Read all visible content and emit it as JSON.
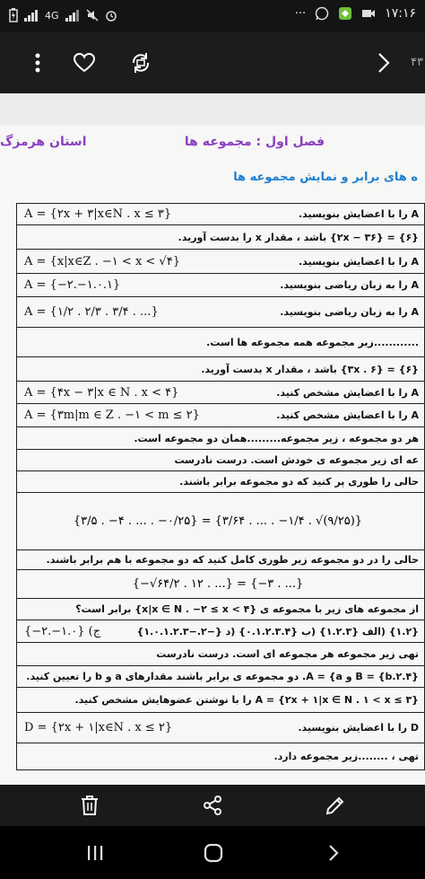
{
  "status_bar": {
    "time": "۱۷:۱۶",
    "network_label": "4G",
    "more": "···"
  },
  "toolbar": {
    "page_indicator": "۴۳"
  },
  "document": {
    "chapter_title": "فصل اول : مجموعه ها",
    "province": "استان هرمزگ",
    "section_title": "ه های برابر و نمایش مجموعه ها",
    "rows": [
      {
        "text": "A را با اعضایش بنویسید.",
        "math": "A = {۲x + ۳|x∈N . x ≤ ۳}"
      },
      {
        "text": "{۶} = {۲x − ۳۶} باشد ، مقدار x را بدست آورید.",
        "math": ""
      },
      {
        "text": "A را با اعضایش بنویسید.",
        "math": "A = {x|x∈Z . −۱ < x < √۴}"
      },
      {
        "text": "A را به زبان ریاضی بنویسید.",
        "math": "A = {−۲.−۱.۰.۱}"
      },
      {
        "text": "A را به زبان ریاضی بنویسید.",
        "math": "A = {۱/۲ . ۲/۳ . ۳/۴ . ...}"
      },
      {
        "text": "............زیر مجموعه همه مجموعه ها است.",
        "math": ""
      },
      {
        "text": "{۶} = {۳x . ۶} باشد ، مقدار x بدست آورید.",
        "math": ""
      },
      {
        "text": "A را با اعضایش مشخص کنید.",
        "math": "A = {۴x − ۳|x ∈ N . x < ۴}"
      },
      {
        "text": "A را با اعضایش مشخص کنید.",
        "math": "A = {۳m|m ∈ Z . −۱ < m ≤ ۲}"
      },
      {
        "text": "هر دو مجموعه ، زیر مجموعه.........همان دو مجموعه است.",
        "math": ""
      },
      {
        "text": "عه ای زیر مجموعه ی خودش است.   درست   نادرست",
        "math": ""
      },
      {
        "text": "حالی را طوری پر کنید که دو مجموعه برابر باشند.",
        "math": ""
      },
      {
        "text": "",
        "math": "{۳/۵ . −۴ . ... . −۰/۲۵} = {۳/۶۴ . ... . −۱/۴ . √(۹/۲۵)}"
      },
      {
        "text": "حالی را در دو مجموعه زیر طوری کامل کنید که دو مجموعه با هم برابر باشند.",
        "math": ""
      },
      {
        "text": "",
        "math": "{−√۶۴/۲ . ۱۲ . ...} = {−۳ . ...}"
      },
      {
        "text": "از مجموعه های زیر با مجموعه ی {x|x ∈ N . −۲ ≤ x < ۴} برابر است؟",
        "math": ""
      },
      {
        "text": "{۱.۲} (الف   {۱.۲.۳} (ب   {۰.۱.۲.۳.۴} (د   {−۲.−۱.۰.۱.۲.۳}",
        "math": "{−۲.−۱.۰} (ج"
      },
      {
        "text": "تهی زیر مجموعه هر مجموعه ای است.   درست   نادرست",
        "math": ""
      },
      {
        "text": "B = {b.۲.۴} و A = {a. دو مجموعه ی برابر باشند مقدارهای a و b را تعیین کنید.",
        "math": ""
      },
      {
        "text": "A = {۲x + ۱|x ∈ N . ۱ < x ≤ ۳} را با نوشتن عضوهایش مشخص کنید.",
        "math": ""
      },
      {
        "text": "D را با اعضایش بنویسید.",
        "math": "D = {۲x + ۱|x∈N . x ≤ ۲}"
      },
      {
        "text": "تهی ، ........زیر مجموعه دارد.",
        "math": ""
      }
    ]
  },
  "icons": {
    "menu": "more-vert-icon",
    "like": "heart-icon",
    "rotate": "rotate-icon",
    "next": "chevron-right-icon",
    "delete": "trash-icon",
    "share": "share-icon",
    "edit": "pencil-icon"
  }
}
